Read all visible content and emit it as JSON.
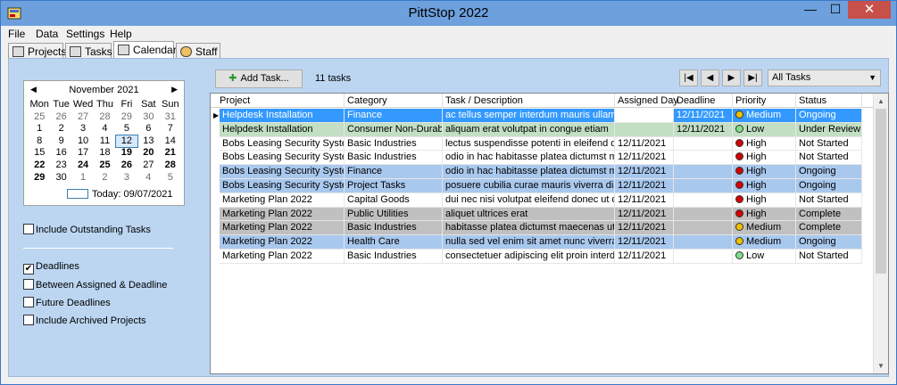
{
  "window": {
    "title": "PittStop 2022",
    "minimize_glyph": "—",
    "maximize_glyph": "☐",
    "close_glyph": "✕"
  },
  "menu": [
    "File",
    "Data",
    "Settings",
    "Help"
  ],
  "tabs": [
    {
      "label": "Projects",
      "icon": "projects-icon",
      "active": false
    },
    {
      "label": "Tasks",
      "icon": "tasks-icon",
      "active": false
    },
    {
      "label": "Calendar",
      "icon": "calendar-icon",
      "active": true
    },
    {
      "label": "Staff",
      "icon": "staff-icon",
      "active": false
    }
  ],
  "calendar": {
    "month": "November 2021",
    "prev_glyph": "◀",
    "next_glyph": "▶",
    "days_of_week": [
      "Mon",
      "Tue",
      "Wed",
      "Thu",
      "Fri",
      "Sat",
      "Sun"
    ],
    "weeks": [
      [
        {
          "d": "25",
          "o": true
        },
        {
          "d": "26",
          "o": true
        },
        {
          "d": "27",
          "o": true
        },
        {
          "d": "28",
          "o": true
        },
        {
          "d": "29",
          "o": true
        },
        {
          "d": "30",
          "o": true
        },
        {
          "d": "31",
          "o": true
        }
      ],
      [
        {
          "d": "1"
        },
        {
          "d": "2"
        },
        {
          "d": "3"
        },
        {
          "d": "4"
        },
        {
          "d": "5"
        },
        {
          "d": "6"
        },
        {
          "d": "7"
        }
      ],
      [
        {
          "d": "8"
        },
        {
          "d": "9"
        },
        {
          "d": "10"
        },
        {
          "d": "11"
        },
        {
          "d": "12",
          "sel": true
        },
        {
          "d": "13"
        },
        {
          "d": "14"
        }
      ],
      [
        {
          "d": "15"
        },
        {
          "d": "16"
        },
        {
          "d": "17"
        },
        {
          "d": "18"
        },
        {
          "d": "19",
          "b": true
        },
        {
          "d": "20",
          "b": true
        },
        {
          "d": "21",
          "b": true
        }
      ],
      [
        {
          "d": "22",
          "b": true
        },
        {
          "d": "23"
        },
        {
          "d": "24",
          "b": true
        },
        {
          "d": "25",
          "b": true
        },
        {
          "d": "26",
          "b": true
        },
        {
          "d": "27"
        },
        {
          "d": "28",
          "b": true
        }
      ],
      [
        {
          "d": "29",
          "b": true
        },
        {
          "d": "30"
        },
        {
          "d": "1",
          "o": true
        },
        {
          "d": "2",
          "o": true
        },
        {
          "d": "3",
          "o": true
        },
        {
          "d": "4",
          "o": true
        },
        {
          "d": "5",
          "o": true
        }
      ]
    ],
    "today_label": "Today: 09/07/2021"
  },
  "options": {
    "include_outstanding": {
      "label": "Include Outstanding Tasks",
      "checked": false
    },
    "deadlines": {
      "label": "Deadlines",
      "checked": true
    },
    "between": {
      "label": "Between Assigned & Deadline",
      "checked": false
    },
    "future": {
      "label": "Future Deadlines",
      "checked": false
    },
    "archived": {
      "label": "Include Archived Projects",
      "checked": false
    }
  },
  "toolbar": {
    "add_task_label": "Add Task...",
    "task_count": "11 tasks",
    "first_glyph": "|◀",
    "prev_glyph": "◀",
    "next_glyph": "▶",
    "last_glyph": "▶|",
    "filter_value": "All Tasks"
  },
  "grid": {
    "columns": [
      "Project",
      "Category",
      "Task / Description",
      "Assigned Day",
      "Deadline",
      "Priority",
      "Status"
    ],
    "rows": [
      {
        "project": "Helpdesk Installation",
        "category": "Finance",
        "task": "ac tellus semper interdum mauris ullamcorper",
        "assigned": "",
        "deadline": "12/11/2021",
        "priority": "Medium",
        "status": "Ongoing",
        "style": "selected"
      },
      {
        "project": "Helpdesk Installation",
        "category": "Consumer Non-Durables",
        "task": "aliquam erat volutpat in congue etiam",
        "assigned": "",
        "deadline": "12/11/2021",
        "priority": "Low",
        "status": "Under Review",
        "style": "green"
      },
      {
        "project": "Bobs Leasing Security System",
        "category": "Basic Industries",
        "task": "lectus suspendisse potenti in eleifend quam a",
        "assigned": "12/11/2021",
        "deadline": "",
        "priority": "High",
        "status": "Not Started",
        "style": "white"
      },
      {
        "project": "Bobs Leasing Security System",
        "category": "Basic Industries",
        "task": "odio in hac habitasse platea dictumst maecena",
        "assigned": "12/11/2021",
        "deadline": "",
        "priority": "High",
        "status": "Not Started",
        "style": "white"
      },
      {
        "project": "Bobs Leasing Security System",
        "category": "Finance",
        "task": "odio in hac habitasse platea dictumst maecena",
        "assigned": "12/11/2021",
        "deadline": "",
        "priority": "High",
        "status": "Ongoing",
        "style": "blue"
      },
      {
        "project": "Bobs Leasing Security System",
        "category": "Project Tasks",
        "task": "posuere cubilia curae mauris viverra diam",
        "assigned": "12/11/2021",
        "deadline": "",
        "priority": "High",
        "status": "Ongoing",
        "style": "blue"
      },
      {
        "project": "Marketing Plan 2022",
        "category": "Capital Goods",
        "task": "dui nec nisi volutpat eleifend donec ut dolor m",
        "assigned": "12/11/2021",
        "deadline": "",
        "priority": "High",
        "status": "Not Started",
        "style": "white"
      },
      {
        "project": "Marketing Plan 2022",
        "category": "Public Utilities",
        "task": "aliquet ultrices erat",
        "assigned": "12/11/2021",
        "deadline": "",
        "priority": "High",
        "status": "Complete",
        "style": "gray"
      },
      {
        "project": "Marketing Plan 2022",
        "category": "Basic Industries",
        "task": "habitasse platea dictumst maecenas ut massa",
        "assigned": "12/11/2021",
        "deadline": "",
        "priority": "Medium",
        "status": "Complete",
        "style": "gray"
      },
      {
        "project": "Marketing Plan 2022",
        "category": "Health Care",
        "task": "nulla sed vel enim sit amet nunc viverra dapib",
        "assigned": "12/11/2021",
        "deadline": "",
        "priority": "Medium",
        "status": "Ongoing",
        "style": "blue"
      },
      {
        "project": "Marketing Plan 2022",
        "category": "Basic Industries",
        "task": "consectetuer adipiscing elit proin interdum ma",
        "assigned": "12/11/2021",
        "deadline": "",
        "priority": "Low",
        "status": "Not Started",
        "style": "white"
      }
    ]
  },
  "colors": {
    "selected_row": "#3399ff",
    "green_row": "#c2dfc4",
    "blue_row": "#a9c8ee",
    "gray_row": "#c0c0c0",
    "priority_high": "#d40000",
    "priority_medium": "#f0c000",
    "priority_low": "#7ee08a"
  }
}
